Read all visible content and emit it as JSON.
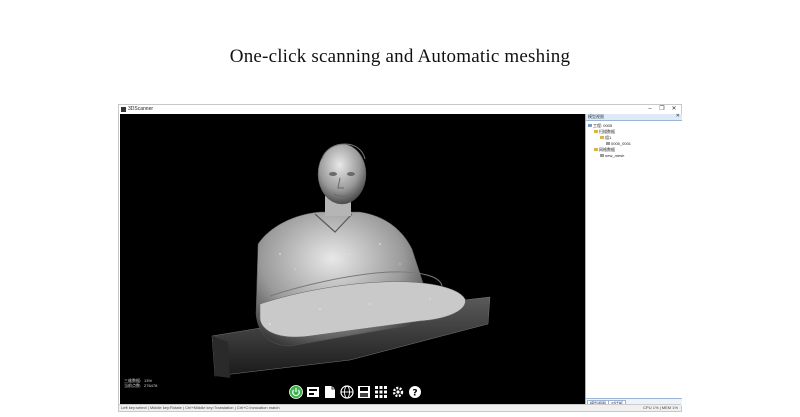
{
  "headline": "One-click scanning and Automatic meshing",
  "window": {
    "title": "3DScanner",
    "controls": {
      "minimize": "–",
      "maximize": "❐",
      "close": "✕"
    }
  },
  "viewport": {
    "subject": "3D scanned bust of a man with folded arms on a pedestal",
    "stats": [
      {
        "label": "三维数据:",
        "value": "13%"
      },
      {
        "label": "当前点数:",
        "value": "276478"
      }
    ]
  },
  "toolbar": {
    "buttons": [
      {
        "icon": "power-icon",
        "active": true
      },
      {
        "icon": "project-icon"
      },
      {
        "icon": "document-icon"
      },
      {
        "icon": "globe-icon"
      },
      {
        "icon": "save-icon"
      },
      {
        "icon": "grid-icon"
      },
      {
        "icon": "settings-icon"
      },
      {
        "icon": "help-icon"
      }
    ]
  },
  "panel": {
    "title": "模型视图",
    "close": "✕",
    "tree": [
      {
        "label": "工程: 0005",
        "level": 0
      },
      {
        "label": "扫描数据",
        "level": 1
      },
      {
        "label": "组1",
        "level": 2
      },
      {
        "label": "0005_0001",
        "level": 3
      },
      {
        "label": "网格数据",
        "level": 1
      },
      {
        "label": "new_mesh",
        "level": 2
      }
    ],
    "tabs": [
      "模型视图",
      "对话框"
    ]
  },
  "statusbar": {
    "text": "Left key:select | Middle key:Rotate | Ctrl+Middle key:Translation | Ctrl+C:Invocation match",
    "right": "CPU 1%  |  MEM 1%"
  },
  "colors": {
    "viewport_bg": "#000000",
    "panel_border": "#9db4d6",
    "power_green": "#3cb34a"
  }
}
